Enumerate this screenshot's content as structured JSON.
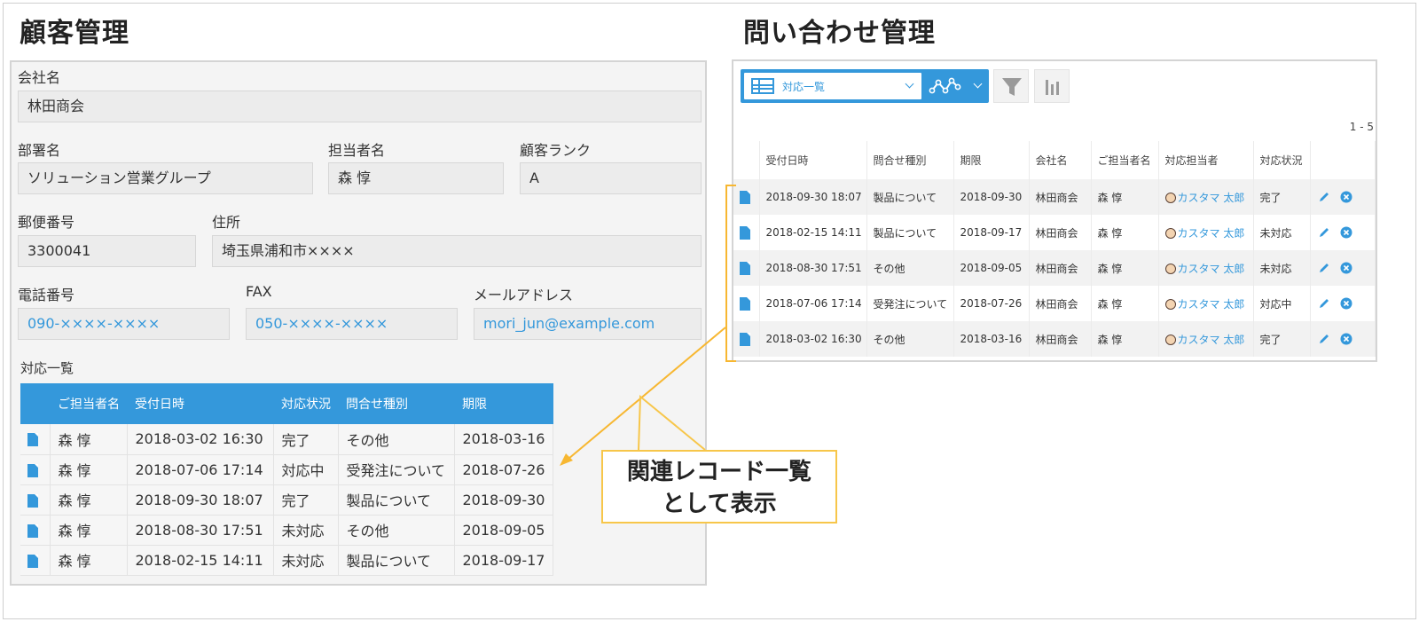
{
  "left": {
    "title": "顧客管理",
    "fields": {
      "company": {
        "label": "会社名",
        "value": "林田商会"
      },
      "department": {
        "label": "部署名",
        "value": "ソリューション営業グループ"
      },
      "person": {
        "label": "担当者名",
        "value": "森 惇"
      },
      "rank": {
        "label": "顧客ランク",
        "value": "A"
      },
      "zip": {
        "label": "郵便番号",
        "value": "3300041"
      },
      "address": {
        "label": "住所",
        "value": "埼玉県浦和市××××"
      },
      "phone": {
        "label": "電話番号",
        "value": "090-××××-××××"
      },
      "fax": {
        "label": "FAX",
        "value": "050-××××-××××"
      },
      "email": {
        "label": "メールアドレス",
        "value": "mori_jun@example.com"
      }
    },
    "related": {
      "title": "対応一覧",
      "columns": [
        "ご担当者名",
        "受付日時",
        "対応状況",
        "問合せ種別",
        "期限"
      ],
      "rows": [
        [
          "森 惇",
          "2018-03-02 16:30",
          "完了",
          "その他",
          "2018-03-16"
        ],
        [
          "森 惇",
          "2018-07-06 17:14",
          "対応中",
          "受発注について",
          "2018-07-26"
        ],
        [
          "森 惇",
          "2018-09-30 18:07",
          "完了",
          "製品について",
          "2018-09-30"
        ],
        [
          "森 惇",
          "2018-08-30 17:51",
          "未対応",
          "その他",
          "2018-09-05"
        ],
        [
          "森 惇",
          "2018-02-15 14:11",
          "未対応",
          "製品について",
          "2018-09-17"
        ]
      ]
    }
  },
  "right": {
    "title": "問い合わせ管理",
    "view_name": "対応一覧",
    "pager": "1 - 5",
    "columns": [
      "受付日時",
      "問合せ種別",
      "期限",
      "会社名",
      "ご担当者名",
      "対応担当者",
      "対応状況"
    ],
    "rows": [
      [
        "2018-09-30 18:07",
        "製品について",
        "2018-09-30",
        "林田商会",
        "森 惇",
        "カスタマ 太郎",
        "完了"
      ],
      [
        "2018-02-15 14:11",
        "製品について",
        "2018-09-17",
        "林田商会",
        "森 惇",
        "カスタマ 太郎",
        "未対応"
      ],
      [
        "2018-08-30 17:51",
        "その他",
        "2018-09-05",
        "林田商会",
        "森 惇",
        "カスタマ 太郎",
        "未対応"
      ],
      [
        "2018-07-06 17:14",
        "受発注について",
        "2018-07-26",
        "林田商会",
        "森 惇",
        "カスタマ 太郎",
        "対応中"
      ],
      [
        "2018-03-02 16:30",
        "その他",
        "2018-03-16",
        "林田商会",
        "森 惇",
        "カスタマ 太郎",
        "完了"
      ]
    ]
  },
  "annotation": {
    "line1": "関連レコード一覧",
    "line2": "として表示"
  },
  "colors": {
    "accent": "#3498db",
    "highlight": "#f7b731",
    "panel_bg": "#f4f4f4",
    "field_bg": "#ececec"
  },
  "icons": [
    "document-icon",
    "table-view-icon",
    "graph-icon",
    "filter-icon",
    "bar-chart-icon",
    "edit-icon",
    "delete-icon",
    "avatar-icon"
  ]
}
